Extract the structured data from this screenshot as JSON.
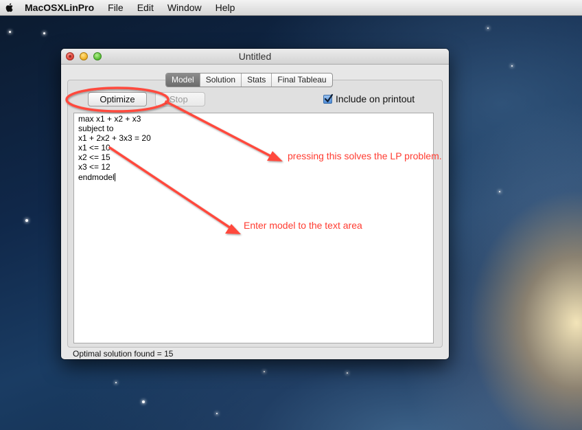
{
  "menubar": {
    "app_name": "MacOSXLinPro",
    "items": [
      "File",
      "Edit",
      "Window",
      "Help"
    ]
  },
  "window": {
    "title": "Untitled",
    "tabs": [
      {
        "label": "Model",
        "active": true
      },
      {
        "label": "Solution",
        "active": false
      },
      {
        "label": "Stats",
        "active": false
      },
      {
        "label": "Final Tableau",
        "active": false
      }
    ],
    "optimize_label": "Optimize",
    "stop_label": "Stop",
    "include_printout": {
      "label": "Include on printout",
      "checked": true
    },
    "model_lines": [
      "max x1 + x2 + x3",
      "subject to",
      "x1 + 2x2 + 3x3 = 20",
      "x1 <= 10",
      "x2 <= 15",
      "x3 <= 12",
      "endmodel"
    ],
    "status": "Optimal solution found = 15"
  },
  "annotations": {
    "optimize_note": "pressing this solves the LP problem.",
    "textarea_note": "Enter model to the text area",
    "color": "#ff3b30"
  }
}
